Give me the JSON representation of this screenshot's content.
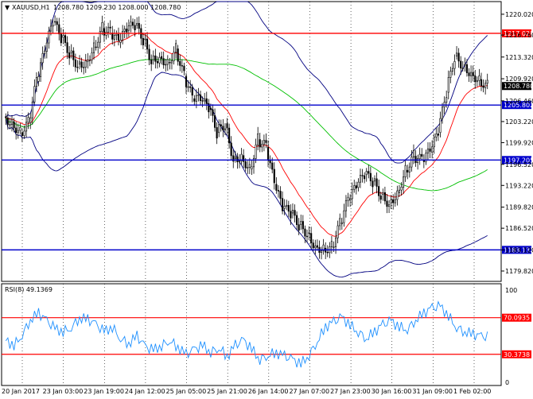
{
  "header": {
    "symbol_tf": "XAUUSD,H1",
    "ohlc": "1208.780 1209.230 1208.000 1208.780"
  },
  "rsi_header": {
    "label": "RSI(8) 49.1369"
  },
  "colors": {
    "level_red": "#ff0000",
    "level_blue": "#0000cc",
    "bollinger": "#000080",
    "ema": "#ff0000",
    "sma": "#00c000",
    "rsi_line": "#1e90ff",
    "grid": "#000000",
    "candle": "#000000"
  },
  "chart_data": [
    {
      "type": "candlestick",
      "ylim": [
        1178.2,
        1222.0
      ],
      "price_ticks": [
        "1220.020",
        "1216.760",
        "1213.320",
        "1209.920",
        "1206.460",
        "1203.220",
        "1199.920",
        "1196.520",
        "1193.220",
        "1189.820",
        "1186.520",
        "1183.120",
        "1179.820"
      ],
      "price_tick_values": [
        1220.02,
        1216.76,
        1213.32,
        1209.92,
        1206.46,
        1203.22,
        1199.92,
        1196.52,
        1193.22,
        1189.82,
        1186.52,
        1183.12,
        1179.82
      ],
      "levels": [
        {
          "label": "1217.028",
          "value": 1217.028,
          "color": "red"
        },
        {
          "label": "1205.802",
          "value": 1205.802,
          "color": "blue"
        },
        {
          "label": "1197.205",
          "value": 1197.205,
          "color": "blue"
        },
        {
          "label": "1183.132",
          "value": 1183.132,
          "color": "blue"
        }
      ],
      "current_price_label": "1208.780",
      "current_price": 1208.78,
      "close_series": [
        1203.2,
        1201.5,
        1203.0,
        1209.5,
        1214.2,
        1218.8,
        1216.4,
        1214.0,
        1212.2,
        1212.6,
        1214.9,
        1217.8,
        1217.1,
        1215.6,
        1217.5,
        1218.3,
        1216.1,
        1212.9,
        1213.4,
        1212.5,
        1214.6,
        1210.3,
        1206.8,
        1206.5,
        1205.3,
        1201.5,
        1202.9,
        1197.4,
        1197.9,
        1195.8,
        1200.4,
        1199.2,
        1193.4,
        1189.6,
        1188.9,
        1187.1,
        1185.8,
        1183.8,
        1183.4,
        1183.6,
        1187.2,
        1190.9,
        1192.9,
        1194.9,
        1193.9,
        1191.8,
        1190.5,
        1192.1,
        1195.6,
        1197.8,
        1197.1,
        1198.4,
        1201.5,
        1207.8,
        1213.5,
        1212.1,
        1210.9,
        1209.8,
        1208.8
      ]
    },
    {
      "type": "line",
      "name": "RSI(8)",
      "ylim": [
        0,
        100
      ],
      "levels": [
        {
          "label": "70.0935",
          "value": 70.0935
        },
        {
          "label": "30.3738",
          "value": 30.3738
        }
      ],
      "y_ticks": [
        "100",
        "0"
      ],
      "y_tick_values": [
        100,
        0
      ],
      "values": [
        45,
        40,
        52,
        68,
        75,
        66,
        58,
        55,
        60,
        70,
        68,
        62,
        55,
        60,
        48,
        42,
        50,
        38,
        35,
        40,
        46,
        38,
        30,
        35,
        40,
        33,
        38,
        28,
        40,
        45,
        36,
        25,
        30,
        32,
        28,
        24,
        20,
        30,
        45,
        60,
        65,
        70,
        62,
        55,
        48,
        55,
        62,
        66,
        60,
        58,
        68,
        75,
        80,
        82,
        72,
        60,
        55,
        52,
        49
      ]
    }
  ],
  "x_labels": [
    "20 Jan 2017",
    "23 Jan 03:00",
    "23 Jan 19:00",
    "24 Jan 12:00",
    "25 Jan 05:00",
    "25 Jan 21:00",
    "26 Jan 14:00",
    "27 Jan 07:00",
    "27 Jan 23:00",
    "30 Jan 16:00",
    "31 Jan 09:00",
    "1 Feb 02:00"
  ]
}
